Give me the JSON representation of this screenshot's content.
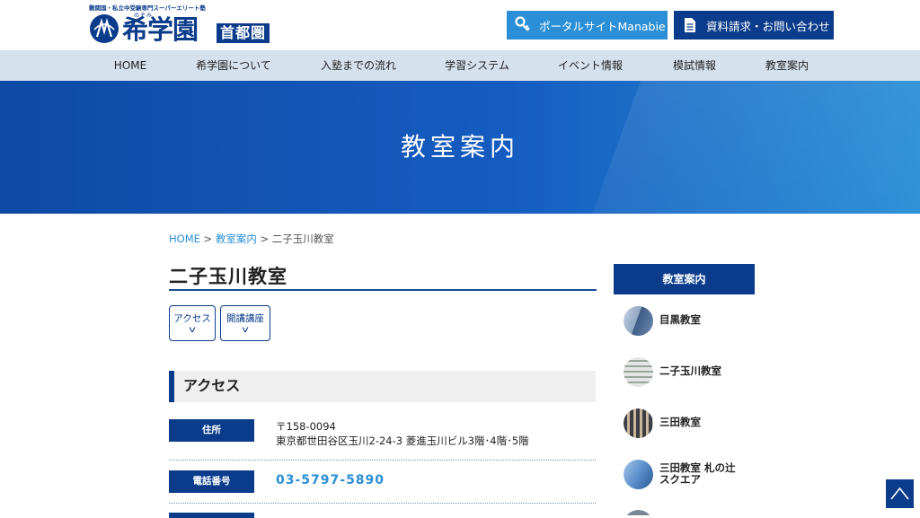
{
  "header": {
    "tagline": "難関国・私立中受験専門スーパーエリート塾",
    "logo_ruby": "のぞみ",
    "logo_text": "希学園",
    "region": "首都圏",
    "portal_label": "ポータルサイトManabie",
    "request_label": "資料請求・お問い合わせ",
    "portal_icon": "key-icon",
    "request_icon": "document-icon"
  },
  "nav": {
    "items": [
      "HOME",
      "希学園について",
      "入塾までの流れ",
      "学習システム",
      "イベント情報",
      "模試情報",
      "教室案内"
    ]
  },
  "hero": {
    "title": "教室案内"
  },
  "breadcrumb": {
    "home": "HOME",
    "sep": ">",
    "parent": "教室案内",
    "current": "二子玉川教室"
  },
  "main": {
    "title": "二子玉川教室",
    "anchors": [
      {
        "label": "アクセス",
        "icon": "chevron-down-icon"
      },
      {
        "label": "開講講座",
        "icon": "chevron-down-icon"
      }
    ],
    "section_title": "アクセス",
    "info": {
      "address_label": "住所",
      "postal": "〒158-0094",
      "address": "東京都世田谷区玉川2-24-3 菱進玉川ビル3階･4階･5階",
      "phone_label": "電話番号",
      "phone": "03-5797-5890"
    }
  },
  "sidebar": {
    "title": "教室案内",
    "items": [
      "目黒教室",
      "二子玉川教室",
      "三田教室",
      "三田教室 札の辻",
      "スクエア"
    ]
  },
  "colors": {
    "navy": "#0b3c8c",
    "accent": "#2a8fd6",
    "nav_bg": "#d6e1ee"
  }
}
